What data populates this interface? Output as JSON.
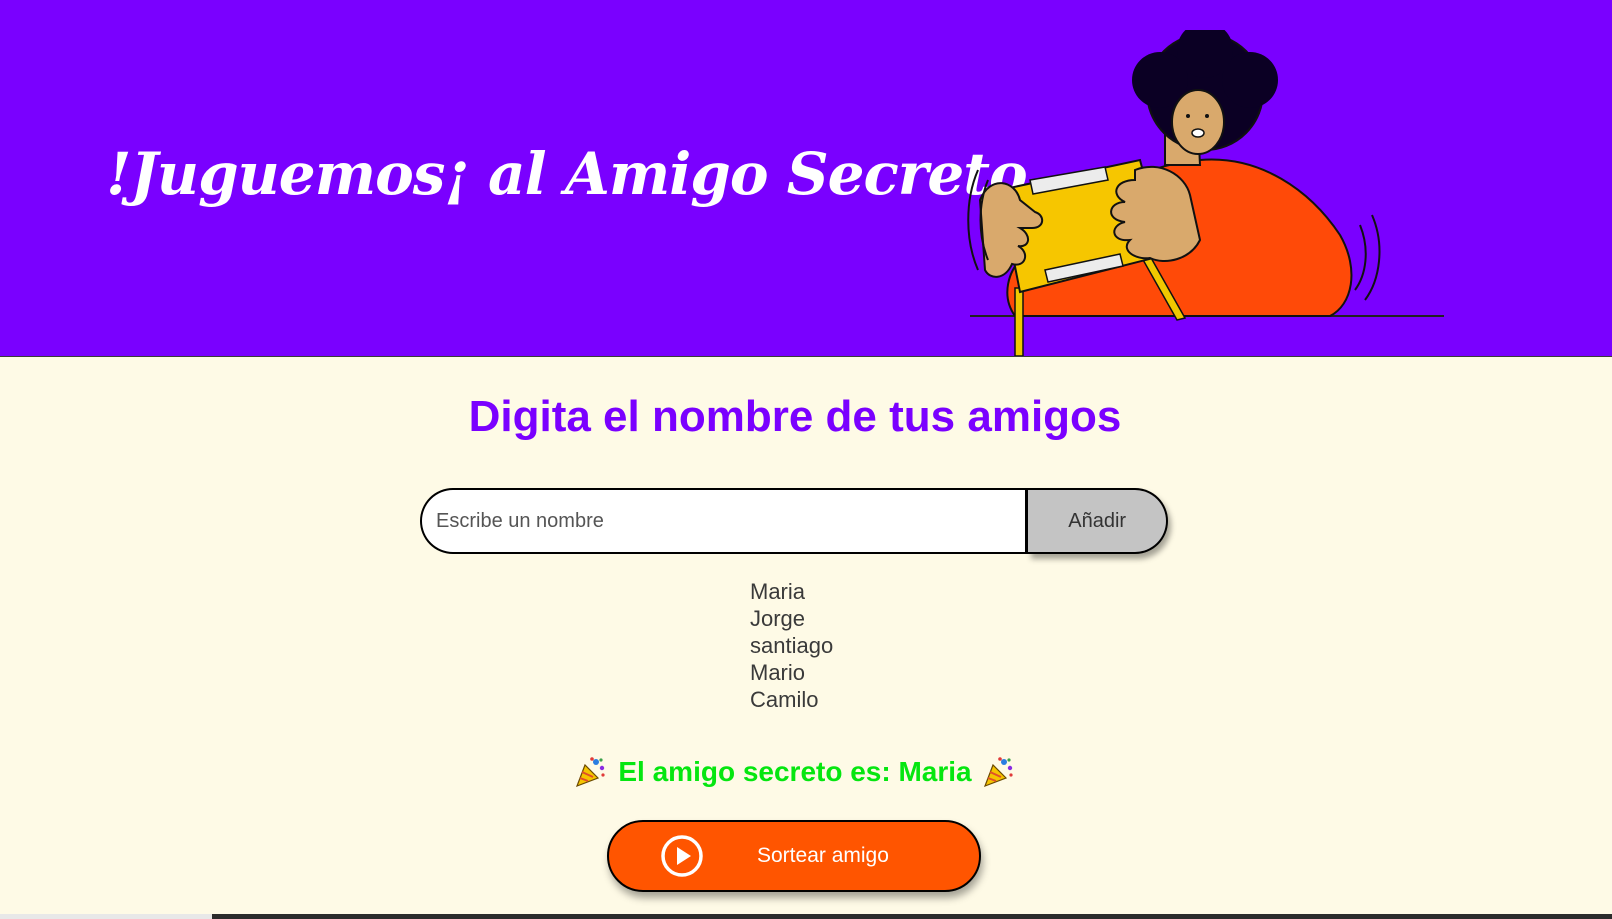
{
  "header": {
    "title": "!Juguemos¡ al Amigo Secreto",
    "background_color": "#7a00ff",
    "illustration": "person-opening-gift-illustration"
  },
  "main": {
    "heading": "Digita el nombre de tus amigos",
    "heading_color": "#7a00ff",
    "background_color": "#fefae6"
  },
  "input": {
    "placeholder": "Escribe un nombre",
    "value": ""
  },
  "add_button": {
    "label": "Añadir",
    "color": "#c4c4c4"
  },
  "friends": [
    "Maria",
    "Jorge",
    "santiago",
    "Mario",
    "Camilo"
  ],
  "result": {
    "text": "El amigo secreto es: Maria",
    "color": "#05e610",
    "icon": "party-popper-icon"
  },
  "draw_button": {
    "label": "Sortear amigo",
    "color": "#ff5500",
    "icon": "play-circle-icon"
  }
}
